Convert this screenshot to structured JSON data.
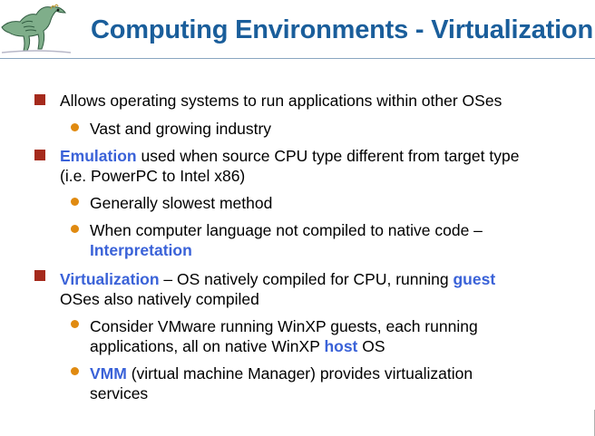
{
  "title": "Computing Environments - Virtualization",
  "colors": {
    "title": "#1a5e9b",
    "keyword": "#3a62d8",
    "level1_bullet": "#a52a1c",
    "level2_bullet": "#e08a10"
  },
  "logo_icon": "dinosaur-icon",
  "bullets": {
    "b1": {
      "text": "Allows operating systems to run applications within other OSes",
      "sub1": "Vast and growing industry"
    },
    "b2": {
      "kw": "Emulation",
      "text": " used when source CPU type different from target type (i.e. PowerPC to Intel x86)",
      "sub1": "Generally slowest method",
      "sub2_text": "When computer language not compiled to native code – ",
      "sub2_kw": "Interpretation"
    },
    "b3": {
      "kw": "Virtualization",
      "text_a": " – OS natively compiled for CPU, running ",
      "kw2": "guest",
      "text_b": " OSes  also natively compiled",
      "sub1_text": "Consider VMware running WinXP guests, each running applications, all on native WinXP ",
      "sub1_kw": "host",
      "sub1_tail": " OS",
      "sub2_kw": "VMM",
      "sub2_text": " (virtual machine Manager) provides virtualization services"
    }
  }
}
